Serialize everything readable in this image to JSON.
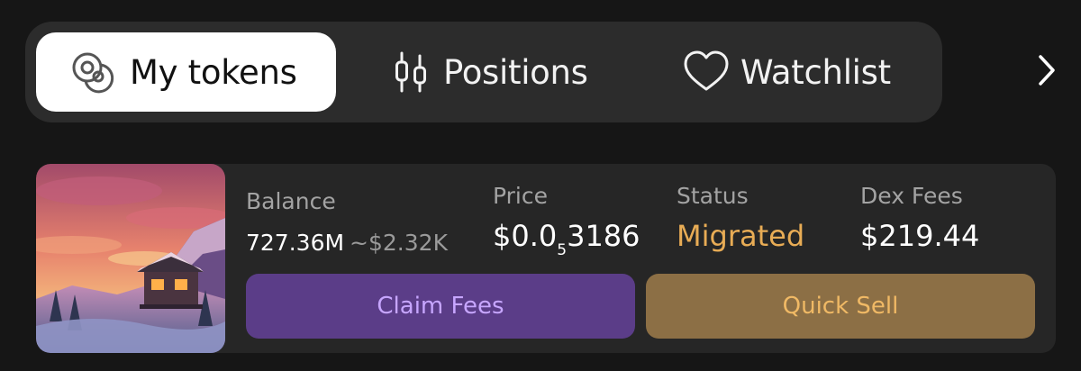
{
  "tabs": {
    "my_tokens": "My tokens",
    "positions": "Positions",
    "watchlist": "Watchlist",
    "active": "my_tokens"
  },
  "icons": {
    "my_tokens": "coins-icon",
    "positions": "candlestick-icon",
    "watchlist": "heart-icon",
    "more": "chevron-right-icon"
  },
  "token": {
    "balance_label": "Balance",
    "balance_amount": "727.36M",
    "balance_usd": "~$2.32K",
    "price_label": "Price",
    "price_prefix": "$0.0",
    "price_zeros": "5",
    "price_digits": "3186",
    "status_label": "Status",
    "status_value": "Migrated",
    "fees_label": "Dex Fees",
    "fees_value": "$219.44",
    "claim_label": "Claim Fees",
    "sell_label": "Quick Sell"
  },
  "colors": {
    "background": "#161616",
    "tabbar": "#2c2c2c",
    "card": "#262626",
    "status_migrated": "#e8ac55",
    "claim_button": "#5b3d88",
    "claim_text": "#c7a6ff",
    "sell_button": "#8c6f45",
    "sell_text": "#f0b965"
  }
}
